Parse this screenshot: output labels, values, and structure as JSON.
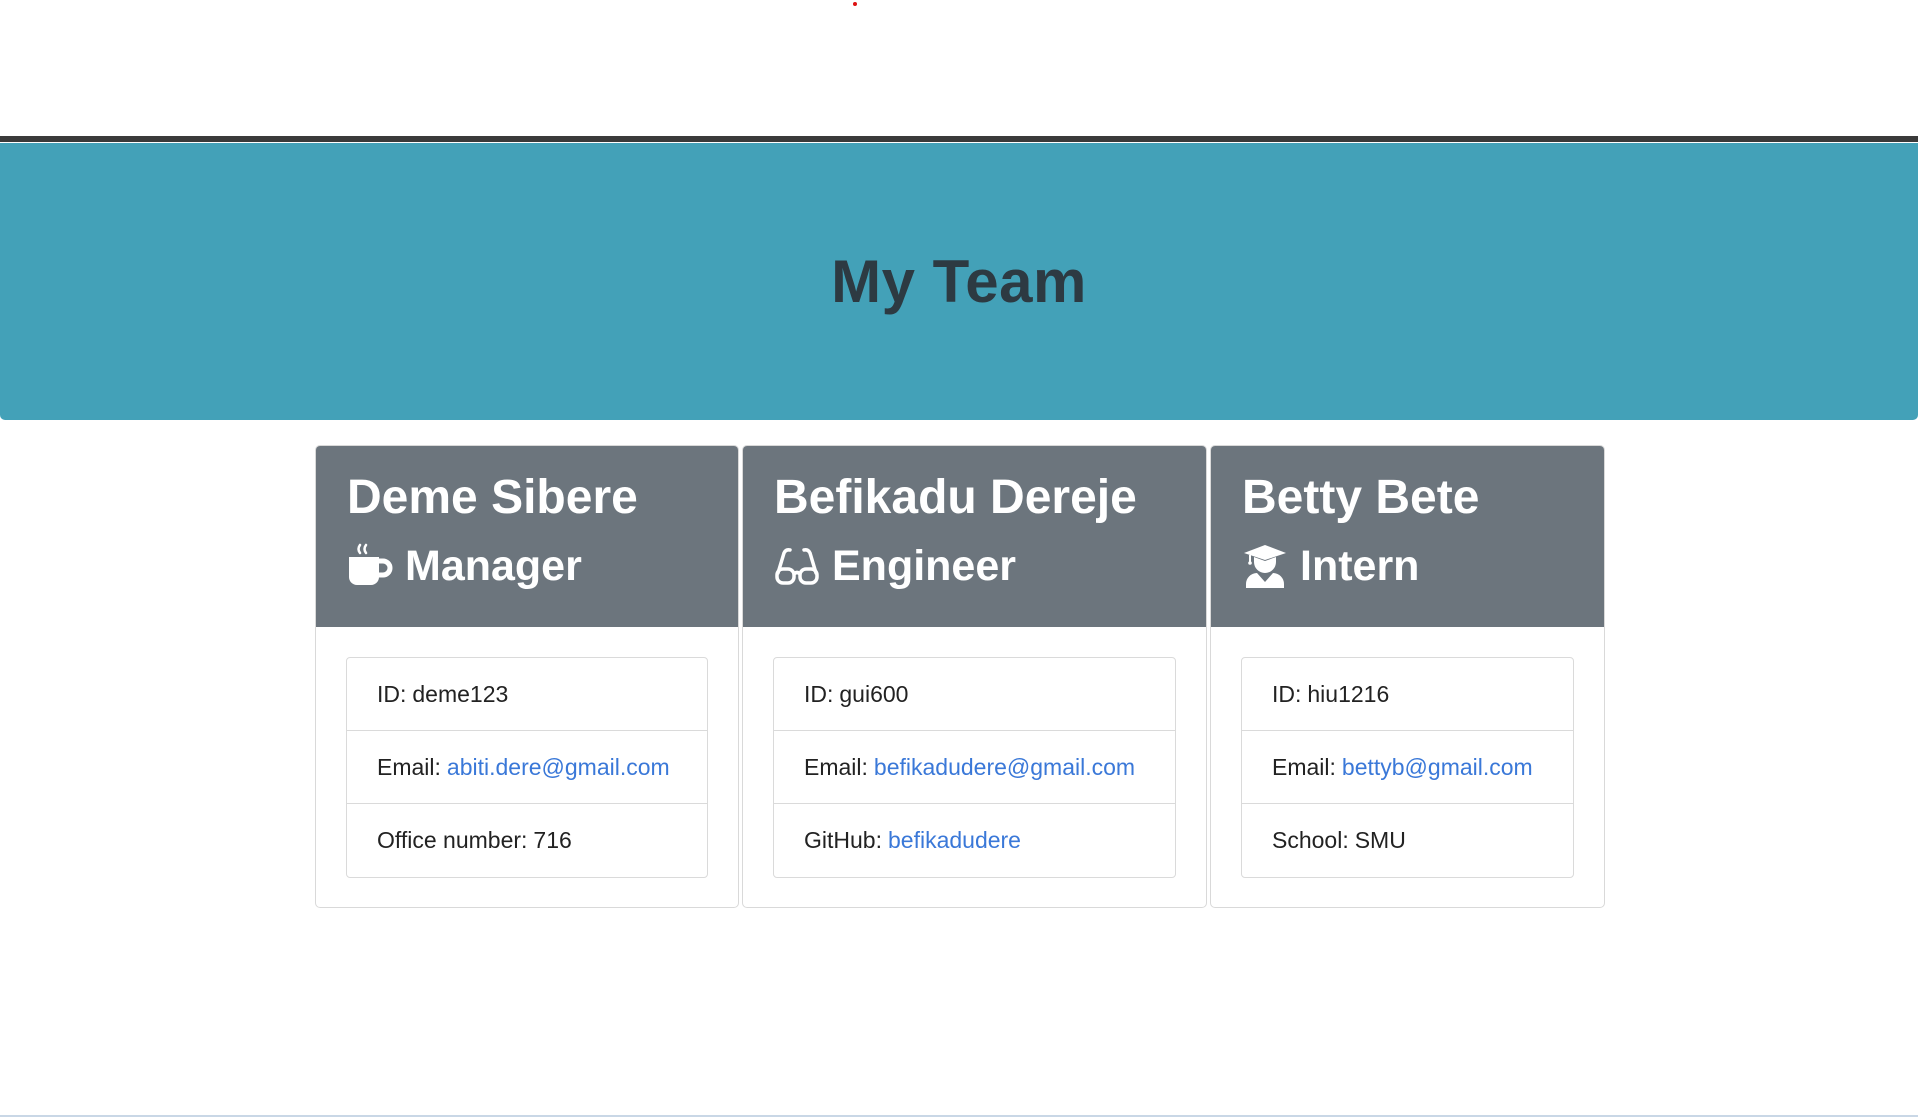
{
  "header": {
    "title": "My Team"
  },
  "cards": [
    {
      "name": "Deme Sibere",
      "role": "Manager",
      "role_icon": "coffee-icon",
      "id_label": "ID:",
      "id_value": "deme123",
      "email_label": "Email:",
      "email_value": "abiti.dere@gmail.com",
      "extra_label": "Office number:",
      "extra_value": "716"
    },
    {
      "name": "Befikadu Dereje",
      "role": "Engineer",
      "role_icon": "glasses-icon",
      "id_label": "ID:",
      "id_value": "gui600",
      "email_label": "Email:",
      "email_value": "befikadudere@gmail.com",
      "extra_label": "GitHub:",
      "extra_value": "befikadudere"
    },
    {
      "name": "Betty Bete",
      "role": "Intern",
      "role_icon": "graduate-icon",
      "id_label": "ID:",
      "id_value": "hiu1216",
      "email_label": "Email:",
      "email_value": "bettyb@gmail.com",
      "extra_label": "School:",
      "extra_value": "SMU"
    }
  ],
  "colors": {
    "jumbotron": "#43a1b8",
    "card_header": "#6c757d",
    "link": "#3a78d8"
  }
}
